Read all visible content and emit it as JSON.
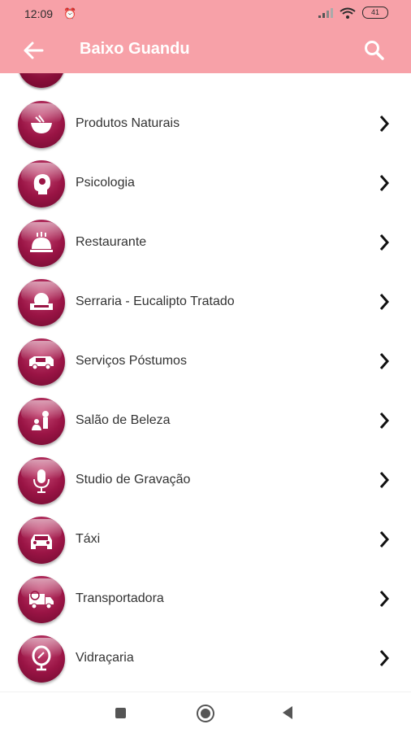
{
  "status": {
    "time": "12:09",
    "battery": "41"
  },
  "appbar": {
    "title": "Baixo Guandu"
  },
  "colors": {
    "appbar": "#f7a1a8",
    "icon": "#9a1445"
  },
  "items": [
    {
      "label": "Produtos Naturais",
      "icon": "bowl-icon"
    },
    {
      "label": "Psicologia",
      "icon": "head-icon"
    },
    {
      "label": "Restaurante",
      "icon": "food-tray-icon"
    },
    {
      "label": "Serraria - Eucalipto Tratado",
      "icon": "saw-icon"
    },
    {
      "label": "Serviços Póstumos",
      "icon": "hearse-icon"
    },
    {
      "label": "Salão de Beleza",
      "icon": "salon-icon"
    },
    {
      "label": "Studio de Gravação",
      "icon": "microphone-icon"
    },
    {
      "label": "Táxi",
      "icon": "taxi-icon"
    },
    {
      "label": "Transportadora",
      "icon": "truck-icon"
    },
    {
      "label": "Vidraçaria",
      "icon": "mirror-icon"
    }
  ]
}
